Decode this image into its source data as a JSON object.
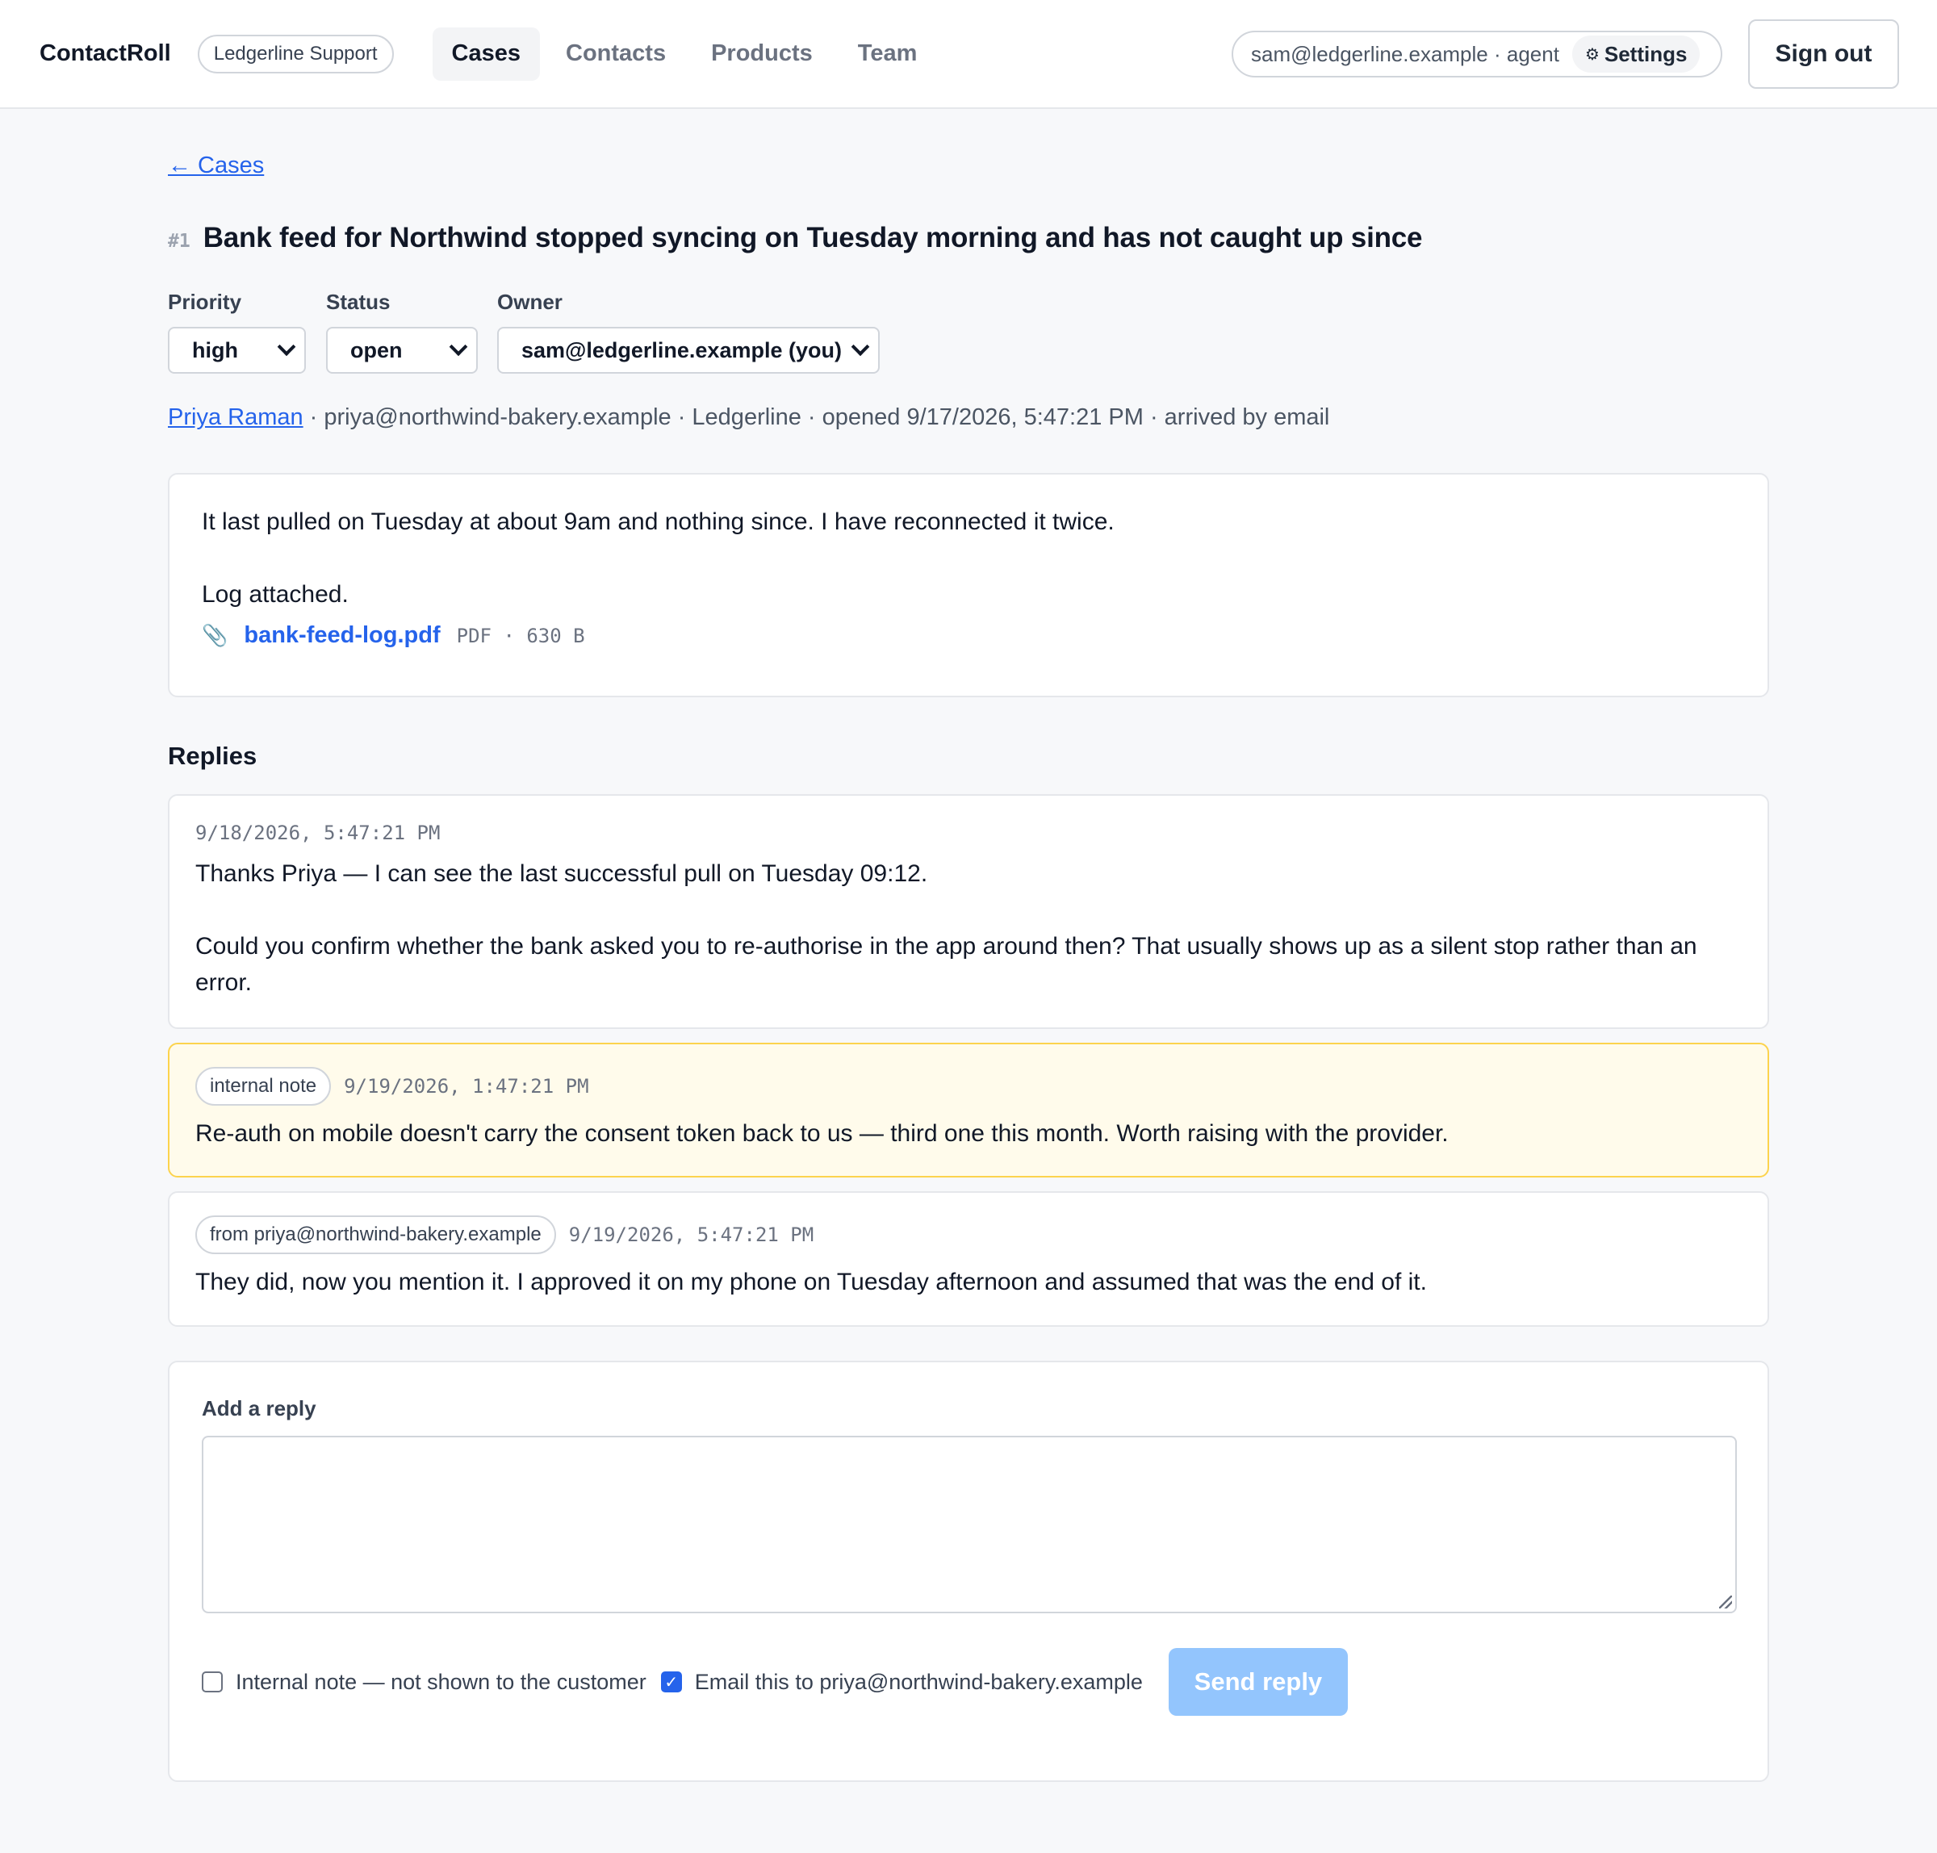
{
  "header": {
    "brand": "ContactRoll",
    "org": "Ledgerline Support",
    "nav": [
      {
        "label": "Cases",
        "active": true
      },
      {
        "label": "Contacts",
        "active": false
      },
      {
        "label": "Products",
        "active": false
      },
      {
        "label": "Team",
        "active": false
      }
    ],
    "user": "sam@ledgerline.example · agent",
    "settings_label": "Settings",
    "settings_icon": "gear-icon",
    "signout_label": "Sign out"
  },
  "case": {
    "back_label": "← Cases",
    "number": "#1",
    "title": "Bank feed for Northwind stopped syncing on Tuesday morning and has not caught up since",
    "fields": {
      "priority": {
        "label": "Priority",
        "value": "high"
      },
      "status": {
        "label": "Status",
        "value": "open"
      },
      "owner": {
        "label": "Owner",
        "value": "sam@ledgerline.example (you)"
      }
    },
    "meta": {
      "contact_name": "Priya Raman",
      "rest": " · priya@northwind-bakery.example · Ledgerline · opened 9/17/2026, 5:47:21 PM · arrived by email"
    },
    "body": {
      "line1": "It last pulled on Tuesday at about 9am and nothing since. I have reconnected it twice.",
      "line2": "Log attached."
    },
    "attachment": {
      "icon": "paperclip-icon",
      "name": "bank-feed-log.pdf",
      "meta": "PDF · 630 B"
    }
  },
  "replies": {
    "title": "Replies",
    "items": [
      {
        "timestamp": "9/18/2026, 5:47:21 PM",
        "para1": "Thanks Priya — I can see the last successful pull on Tuesday 09:12.",
        "para2": "Could you confirm whether the bank asked you to re-authorise in the app around then? That usually shows up as a silent stop rather than an error."
      },
      {
        "tag": "internal note",
        "timestamp": "9/19/2026, 1:47:21 PM",
        "text": "Re-auth on mobile doesn't carry the consent token back to us — third one this month. Worth raising with the provider."
      },
      {
        "tag": "from priya@northwind-bakery.example",
        "timestamp": "9/19/2026, 5:47:21 PM",
        "text": "They did, now you mention it. I approved it on my phone on Tuesday afternoon and assumed that was the end of it."
      }
    ]
  },
  "composer": {
    "label": "Add a reply",
    "value": "",
    "internal_label": "Internal note — not shown to the customer",
    "internal_checked": false,
    "email_label": "Email this to priya@northwind-bakery.example",
    "email_checked": true,
    "send_label": "Send reply"
  },
  "colors": {
    "accent": "#2563eb",
    "note_bg": "#fffbeb",
    "note_border": "#fcd34d",
    "send_disabled": "#93c5fd"
  }
}
